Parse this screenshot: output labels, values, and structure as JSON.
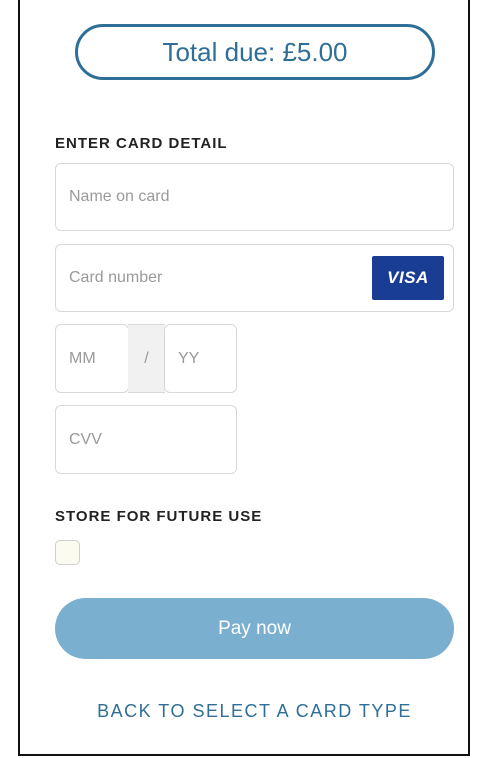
{
  "payment": {
    "total_due": "Total due: £5.00"
  },
  "card_detail": {
    "heading": "ENTER CARD DETAIL",
    "name_placeholder": "Name on card",
    "number_placeholder": "Card number",
    "card_brand": "VISA",
    "expiry_month_placeholder": "MM",
    "expiry_separator": "/",
    "expiry_year_placeholder": "YY",
    "cvv_placeholder": "CVV"
  },
  "store": {
    "heading": "STORE FOR FUTURE USE",
    "checked": false
  },
  "actions": {
    "pay_label": "Pay now",
    "back_label": "BACK TO SELECT A CARD TYPE"
  },
  "colors": {
    "accent": "#2f6e97",
    "pay_button": "#7bafcf",
    "visa_badge": "#1a3d94"
  }
}
